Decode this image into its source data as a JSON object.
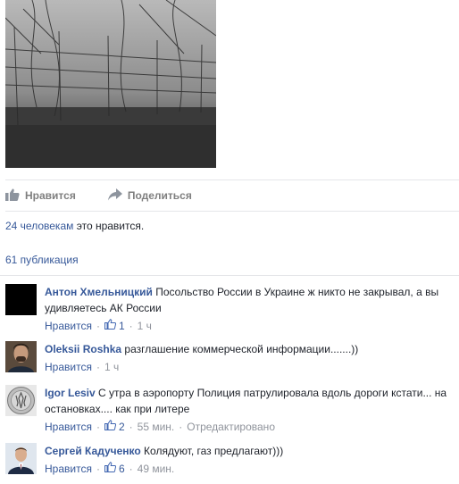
{
  "post_actions": {
    "like_label": "Нравится",
    "share_label": "Поделиться"
  },
  "likes": {
    "count_link": "24 человекам",
    "suffix": "это нравится."
  },
  "shares": {
    "label": "61 публикация"
  },
  "comments": [
    {
      "author": "Антон Хмельницкий",
      "text": "Посольство России в Украине ж никто не закрывал, а вы удивляетесь АК России",
      "like_label": "Нравится",
      "like_count": "1",
      "time": "1 ч",
      "edited": ""
    },
    {
      "author": "Oleksii Roshka",
      "text": "разглашение коммерческой информации.......))",
      "like_label": "Нравится",
      "like_count": "",
      "time": "1 ч",
      "edited": ""
    },
    {
      "author": "Igor Lesiv",
      "text": "С утра в аэропорту Полиция патрулировала вдоль дороги кстати... на остановках.... как при литере",
      "like_label": "Нравится",
      "like_count": "2",
      "time": "55 мин.",
      "edited": "Отредактировано"
    },
    {
      "author": "Сергей Кадученко",
      "text": "Колядуют, газ предлагают)))",
      "like_label": "Нравится",
      "like_count": "6",
      "time": "49 мин.",
      "edited": ""
    }
  ]
}
